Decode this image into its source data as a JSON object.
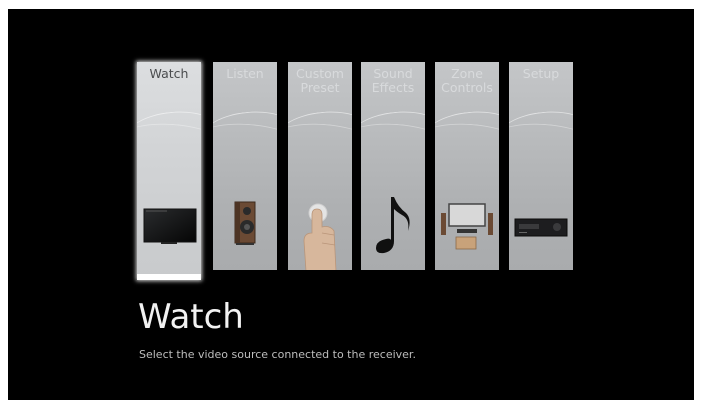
{
  "menu": {
    "tiles": [
      {
        "label": "Watch",
        "icon": "tv-icon",
        "selected": true
      },
      {
        "label": "Listen",
        "icon": "speaker-icon",
        "selected": false
      },
      {
        "label": "Custom\nPreset",
        "icon": "finger-press-icon",
        "selected": false
      },
      {
        "label": "Sound\nEffects",
        "icon": "music-note-icon",
        "selected": false
      },
      {
        "label": "Zone\nControls",
        "icon": "zone-speakers-icon",
        "selected": false
      },
      {
        "label": "Setup",
        "icon": "receiver-icon",
        "selected": false
      }
    ]
  },
  "detail": {
    "title": "Watch",
    "description": "Select the video source connected to the receiver."
  },
  "colors": {
    "background": "#000000",
    "tile": "#b9bbbd",
    "tile_selected": "#d2d4d6",
    "highlight": "#ffffff"
  }
}
